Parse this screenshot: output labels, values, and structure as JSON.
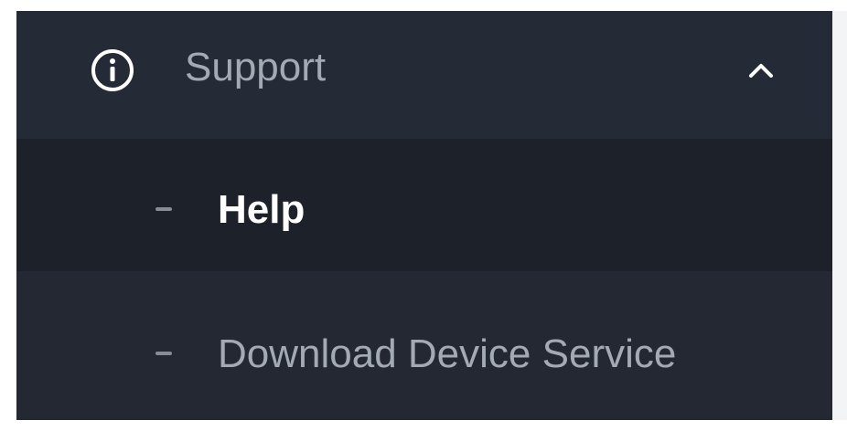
{
  "sidebar": {
    "group": {
      "label": "Support",
      "icon": "info-circle-icon",
      "toggle_icon": "chevron-up-icon",
      "expanded": true
    },
    "items": [
      {
        "label": "Help",
        "active": true
      },
      {
        "label": "Download Device Service",
        "active": false
      }
    ]
  },
  "colors": {
    "sidebar_background": "#232833",
    "active_item_background": "#1d2129",
    "text_muted": "#a4aab4",
    "text_active": "#ffffff"
  }
}
